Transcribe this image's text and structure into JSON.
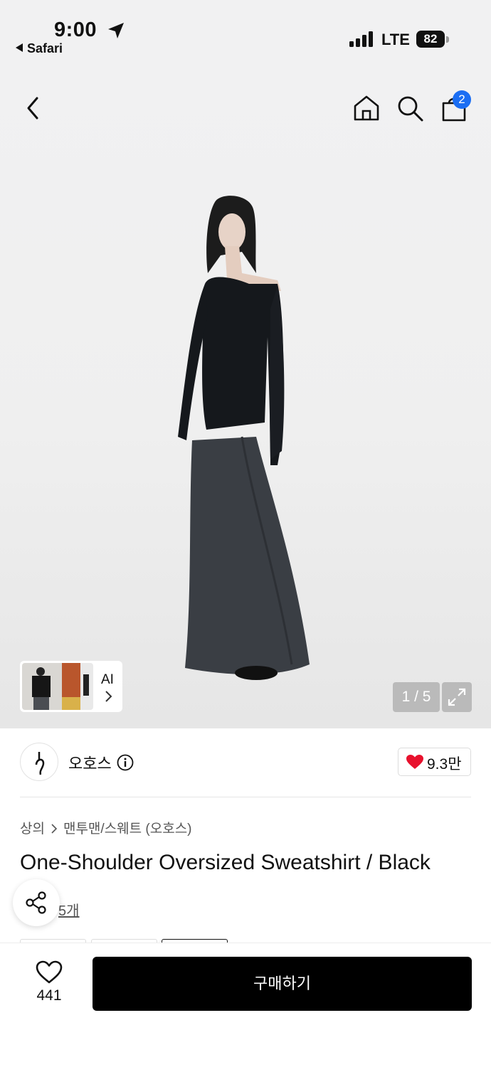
{
  "status_bar": {
    "time": "9:00",
    "back_app": "Safari",
    "network": "LTE",
    "battery": "82"
  },
  "nav": {
    "cart_badge": "2"
  },
  "gallery": {
    "ai_label": "AI",
    "counter": "1 / 5"
  },
  "brand": {
    "name": "오호스",
    "likes": "9.3만"
  },
  "breadcrumb": {
    "category": "상의",
    "subcategory": "맨투맨/스웨트 (오호스)"
  },
  "product": {
    "title": "One-Shoulder Oversized Sweatshirt / Black",
    "review_link_visible": "5개"
  },
  "bottom_bar": {
    "wish_count": "441",
    "buy_label": "구매하기"
  },
  "colors": {
    "accent_badge": "#1b6ef3",
    "heart": "#e8112d",
    "buy_button": "#000000"
  }
}
